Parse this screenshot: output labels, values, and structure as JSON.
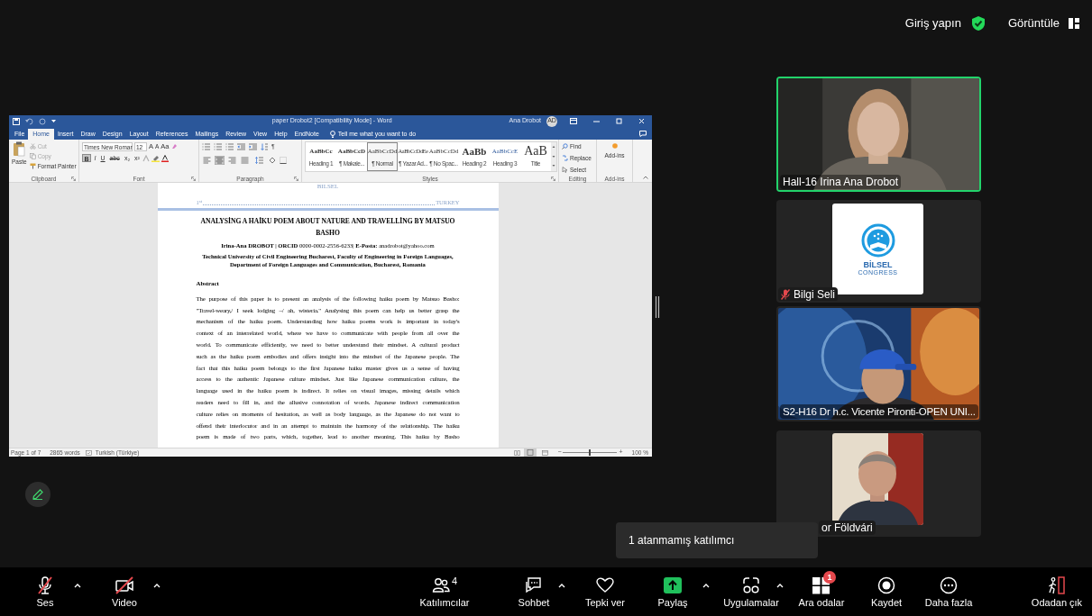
{
  "top_bar": {
    "sign_in": "Giriş yapın",
    "view": "Görüntüle"
  },
  "word": {
    "title": "paper Drobot2 [Compatibility Mode] - Word",
    "user": "Ana Drobot",
    "avatar": "AD",
    "tabs": [
      {
        "label": "File",
        "selected": false
      },
      {
        "label": "Home",
        "selected": true
      },
      {
        "label": "Insert",
        "selected": false
      },
      {
        "label": "Draw",
        "selected": false
      },
      {
        "label": "Design",
        "selected": false
      },
      {
        "label": "Layout",
        "selected": false
      },
      {
        "label": "References",
        "selected": false
      },
      {
        "label": "Mailings",
        "selected": false
      },
      {
        "label": "Review",
        "selected": false
      },
      {
        "label": "View",
        "selected": false
      },
      {
        "label": "Help",
        "selected": false
      },
      {
        "label": "EndNote",
        "selected": false
      }
    ],
    "tell_me": "Tell me what you want to do",
    "clipboard": {
      "label": "Clipboard",
      "paste": "Paste",
      "items": [
        {
          "label": "Cut",
          "disabled": true
        },
        {
          "label": "Copy",
          "disabled": true
        },
        {
          "label": "Format Painter",
          "disabled": false
        }
      ]
    },
    "font": {
      "label": "Font",
      "name": "Times New Romar",
      "size": "12",
      "case_buttons": [
        "A",
        "A",
        "Aa"
      ],
      "format_buttons": [
        {
          "label": "B",
          "selected": true
        },
        {
          "label": "I",
          "selected": false
        },
        {
          "label": "U",
          "selected": false
        },
        {
          "label": "abc",
          "selected": false
        },
        {
          "label": "x₂",
          "selected": false
        },
        {
          "label": "x²",
          "selected": false
        }
      ]
    },
    "paragraph": {
      "label": "Paragraph",
      "show_marks": "¶",
      "alignments": [
        {
          "selected": false
        },
        {
          "selected": true
        },
        {
          "selected": false
        },
        {
          "selected": false
        }
      ]
    },
    "styles": {
      "label": "Styles",
      "items": [
        {
          "preview": "AaBbCc",
          "name": "Heading 1",
          "selected": false
        },
        {
          "preview": "AaBbCcD",
          "name": "¶ Makale...",
          "selected": false
        },
        {
          "preview": "AaBbCcDd",
          "name": "¶ Normal",
          "selected": true
        },
        {
          "preview": "AaBbCcDdEe",
          "name": "¶ Yazar Ad...",
          "selected": false
        },
        {
          "preview": "AaBbCcDd",
          "name": "¶ No Spac...",
          "selected": false
        },
        {
          "preview": "AaBb",
          "name": "Heading 2",
          "selected": false
        },
        {
          "preview": "AaBbCcE",
          "name": "Heading 3",
          "selected": false
        },
        {
          "preview": "AaB",
          "name": "Title",
          "selected": false
        }
      ]
    },
    "editing": {
      "label": "Editing",
      "find": "Find",
      "replace": "Replace",
      "select": "Select"
    },
    "addins": {
      "label": "Add-ins",
      "button": "Add-ins"
    },
    "document": {
      "header_mark": "BILSEL",
      "header_left": "1$^{st}$",
      "header_right": "TURKEY",
      "title": "ANALYSİNG A HAİKU POEM ABOUT NATURE AND TRAVELLİNG BY MATSUO BASHO",
      "author": "**Irina-Ana DROBOT | ORCID** 0000-0002-2556-6233| **E-Posta:** anadrobot@yahoo.com",
      "affiliation": "Technical University of Civil Engineering Bucharest, Faculty of Engineering in Foreign Languages, Department of Foreign Languages and Communication, Bucharest, Romania",
      "heading": "Abstract",
      "lines": [
        "The purpose of this paper is to present an analysis of the following haiku poem by Matsuo Basho:",
        "\"Travel-weary,/ I seek lodging –/ ah, wisteria.\" Analysing this poem can help us better grasp the",
        "mechanism of the haiku poem. Understanding how haiku poems work is important in today's",
        "context of an interrelated world, where we have to communicate with people from all over the",
        "world. To communicate efficiently, we need to better understand their mindset. A cultural product",
        "such as the haiku poem embodies and offers insight into the mindset of the Japanese people. The",
        "fact that this haiku poem belongs to the first Japanese haiku master gives us a sense of having",
        "access to the authentic Japanese culture mindset. Just like Japanese communication culture, the",
        "language used in the haiku poem is indirect. It relies on visual images, missing details which",
        "readers need to fill in, and the allusive connotation of words. Japanese indirect communication",
        "culture relies on moments of hesitation, as well as body language, as the Japanese do not want to",
        "offend their interlocutor and in an attempt to maintain the harmony of the relationship. The haiku",
        "poem is made of two parts, which, together, lead to another meaning. This haiku by Basho"
      ]
    },
    "status_bar": {
      "page": "Page 1 of 7",
      "words": "2865 words",
      "language": "Turkish (Türkiye)",
      "zoom": "100 %",
      "zoom_out": "−",
      "zoom_in": "+",
      "zoom_slider": {
        "level": 0.5
      }
    }
  },
  "participants": [
    {
      "name": "Hall-16 Irina Ana Drobot",
      "speaking": true,
      "muted": false,
      "kind": "video"
    },
    {
      "name": "Bilgi Seli",
      "speaking": false,
      "muted": true,
      "kind": "logo",
      "logo_text": "BİLSEL",
      "logo_subtext": "CONGRESS"
    },
    {
      "name": "S2-H16 Dr h.c. Vicente Pironti-OPEN UNI...",
      "speaking": false,
      "muted": false,
      "kind": "video"
    },
    {
      "name": "or Földvári",
      "speaking": false,
      "muted": false
    }
  ],
  "tooltip": "1 atanmamış katılımcı",
  "toolbar": {
    "audio": {
      "label": "Ses",
      "muted": true
    },
    "video": {
      "label": "Video",
      "off": true
    },
    "participants": {
      "label": "Katılımcılar",
      "count": "4"
    },
    "chat": {
      "label": "Sohbet"
    },
    "react": {
      "label": "Tepki ver"
    },
    "share": {
      "label": "Paylaş"
    },
    "apps": {
      "label": "Uygulamalar"
    },
    "breakout": {
      "label": "Ara odalar",
      "badge": "1"
    },
    "record": {
      "label": "Kaydet"
    },
    "more": {
      "label": "Daha fazla"
    },
    "leave": {
      "label": "Odadan çık"
    }
  }
}
